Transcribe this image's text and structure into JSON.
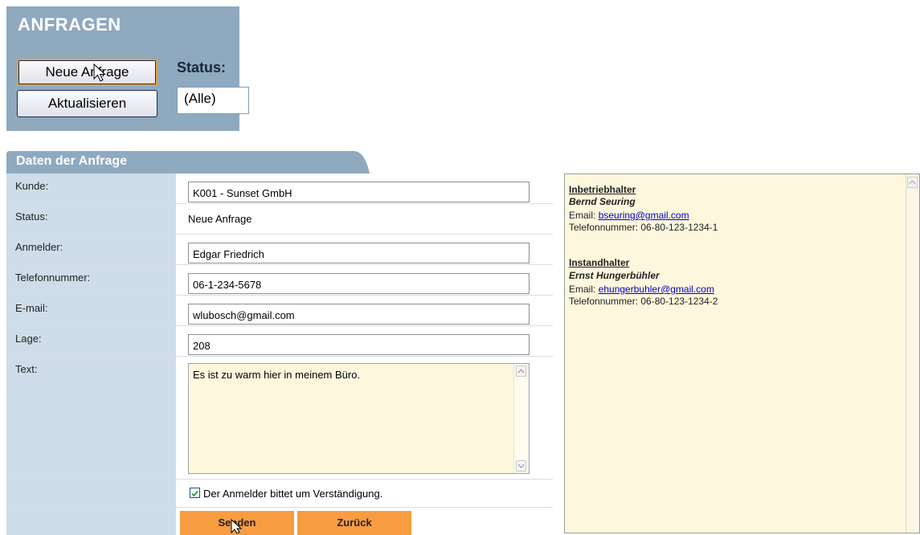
{
  "toolbar": {
    "title": "ANFRAGEN",
    "new_request_label": "Neue Anfrage",
    "refresh_label": "Aktualisieren",
    "status_label": "Status:",
    "status_value": "(Alle)"
  },
  "panel": {
    "title": "Daten der Anfrage"
  },
  "form": {
    "customer": {
      "label": "Kunde:",
      "value": "K001 - Sunset GmbH"
    },
    "status": {
      "label": "Status:",
      "value": "Neue Anfrage"
    },
    "reporter": {
      "label": "Anmelder:",
      "value": "Edgar Friedrich"
    },
    "phone": {
      "label": "Telefonnummer:",
      "value": "06-1-234-5678"
    },
    "email": {
      "label": "E-mail:",
      "value": "wlubosch@gmail.com"
    },
    "location": {
      "label": "Lage:",
      "value": "208"
    },
    "text": {
      "label": "Text:",
      "value": "Es ist zu warm hier in meinem Büro."
    },
    "notify_label": "Der Anmelder bittet um Verständigung.",
    "notify_checked": true,
    "send_label": "Senden",
    "back_label": "Zurück"
  },
  "contacts": {
    "operator": {
      "role": "Inbetriebhalter",
      "name": "Bernd Seuring",
      "email_prefix": "Email: ",
      "email": "bseuring@gmail.com",
      "phone": "Telefonnummer: 06-80-123-1234-1"
    },
    "maintainer": {
      "role": "Instandhalter",
      "name": "Ernst Hungerbühler",
      "email_prefix": "Email: ",
      "email": "ehungerbuhler@gmail.com",
      "phone": "Telefonnummer: 06-80-123-1234-2"
    }
  },
  "colors": {
    "header_blue": "#8fa9bf",
    "label_blue": "#cedde9",
    "note_yellow": "#fdf7dd",
    "action_orange": "#f89c42"
  }
}
